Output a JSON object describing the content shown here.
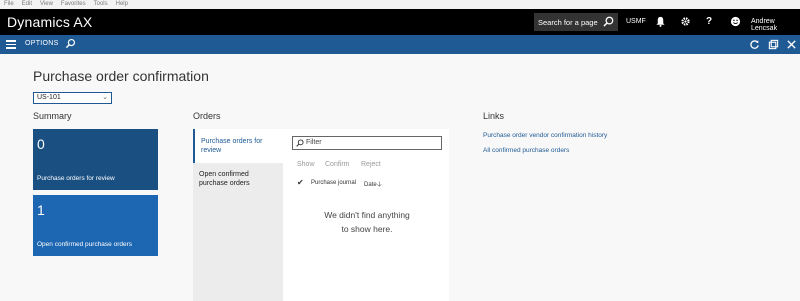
{
  "menu": [
    "File",
    "Edit",
    "View",
    "Favorites",
    "Tools",
    "Help"
  ],
  "header": {
    "brand": "Dynamics AX",
    "search_placeholder": "Search for a page",
    "company": "USMF",
    "user": "Andrew Lencsak"
  },
  "actionbar": {
    "options_label": "OPTIONS"
  },
  "page": {
    "title": "Purchase order confirmation",
    "vendor_select": "US-101"
  },
  "summary": {
    "heading": "Summary",
    "tiles": [
      {
        "count": "0",
        "label": "Purchase orders for review"
      },
      {
        "count": "1",
        "label": "Open confirmed purchase orders"
      }
    ]
  },
  "orders": {
    "heading": "Orders",
    "tabs": [
      "Purchase orders for review",
      "Open confirmed purchase orders"
    ],
    "filter_placeholder": "Filter",
    "actions": [
      "Show",
      "Confirm",
      "Reject"
    ],
    "columns": [
      "Purchase journal",
      "Date"
    ],
    "empty_line1": "We didn't find anything",
    "empty_line2": "to show here."
  },
  "links": {
    "heading": "Links",
    "items": [
      "Purchase order vendor confirmation history",
      "All confirmed purchase orders"
    ]
  },
  "colors": {
    "navbar": "#000000",
    "actionbar": "#1f5a95",
    "tile_dark": "#1a4f82",
    "tile_light": "#1d66b1"
  }
}
